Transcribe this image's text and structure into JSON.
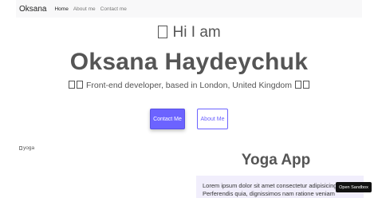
{
  "navbar": {
    "brand": "Oksana",
    "links": [
      "Home",
      "About me",
      "Contact me"
    ]
  },
  "hero": {
    "greeting": "Hi I am",
    "name": "Oksana Haydeychuk",
    "subtitle": "Front-end developer, based in London, United Kingdom",
    "buttons": {
      "contact": "Contact Me",
      "about": "About Me"
    }
  },
  "project": {
    "image_alt": "yoga",
    "title": "Yoga App",
    "description_lines": [
      "Lorem ipsum dolor sit amet consectetur adipisicing elit",
      "Perferendis quia, dignissimos nam ratione veniam"
    ]
  },
  "sandbox": {
    "label": "Open Sandbox"
  },
  "colors": {
    "accent": "#6c63ff",
    "navbar_bg": "#f8f8f9",
    "card_bg": "#f1eefc"
  }
}
